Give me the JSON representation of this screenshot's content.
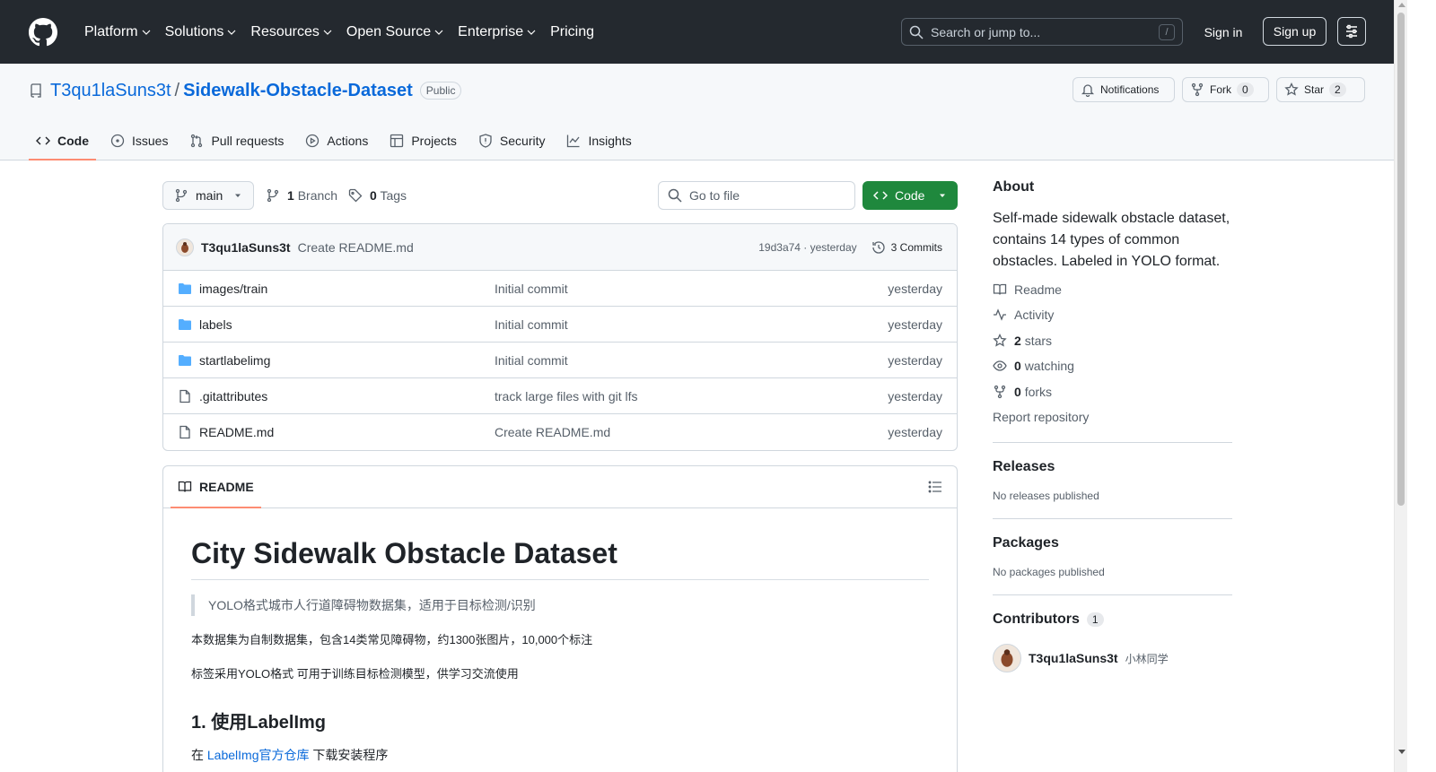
{
  "header": {
    "nav": [
      "Platform",
      "Solutions",
      "Resources",
      "Open Source",
      "Enterprise"
    ],
    "pricing": "Pricing",
    "search_placeholder": "Search or jump to...",
    "search_shortcut": "/",
    "sign_in": "Sign in",
    "sign_up": "Sign up"
  },
  "repo": {
    "owner": "T3qu1laSuns3t",
    "separator": "/",
    "name": "Sidewalk-Obstacle-Dataset",
    "visibility": "Public",
    "notifications": "Notifications",
    "fork_label": "Fork",
    "fork_count": "0",
    "star_label": "Star",
    "star_count": "2",
    "tabs": [
      "Code",
      "Issues",
      "Pull requests",
      "Actions",
      "Projects",
      "Security",
      "Insights"
    ]
  },
  "toolbar": {
    "branch": "main",
    "branch_count": "1",
    "branch_label": "Branch",
    "tag_count": "0",
    "tag_label": "Tags",
    "goto_placeholder": "Go to file",
    "code_button": "Code"
  },
  "latest_commit": {
    "author": "T3qu1laSuns3t",
    "message": "Create README.md",
    "sha_time": "19d3a74 · yesterday",
    "commits": "3 Commits"
  },
  "files": [
    {
      "type": "folder",
      "name": "images/train",
      "message": "Initial commit",
      "date": "yesterday"
    },
    {
      "type": "folder",
      "name": "labels",
      "message": "Initial commit",
      "date": "yesterday"
    },
    {
      "type": "folder",
      "name": "startlabelimg",
      "message": "Initial commit",
      "date": "yesterday"
    },
    {
      "type": "file",
      "name": ".gitattributes",
      "message": "track large files with git lfs",
      "date": "yesterday"
    },
    {
      "type": "file",
      "name": "README.md",
      "message": "Create README.md",
      "date": "yesterday"
    }
  ],
  "readme": {
    "tab": "README",
    "title": "City Sidewalk Obstacle Dataset",
    "quote": "YOLO格式城市人行道障碍物数据集，适用于目标检测/识别",
    "para1": "本数据集为自制数据集，包含14类常见障碍物，约1300张图片，10,000个标注",
    "para2": "标签采用YOLO格式 可用于训练目标检测模型，供学习交流使用",
    "h2": "1. 使用LabelImg",
    "p2_prefix": "在",
    "p2_link": "LabelImg官方仓库",
    "p2_suffix": "下载安装程序"
  },
  "sidebar": {
    "about_title": "About",
    "description": "Self-made sidewalk obstacle dataset, contains 14 types of common obstacles. Labeled in YOLO format.",
    "readme": "Readme",
    "activity": "Activity",
    "stars_count": "2",
    "stars_label": "stars",
    "watching_count": "0",
    "watching_label": "watching",
    "forks_count": "0",
    "forks_label": "forks",
    "report": "Report repository",
    "releases_title": "Releases",
    "releases_empty": "No releases published",
    "packages_title": "Packages",
    "packages_empty": "No packages published",
    "contributors_title": "Contributors",
    "contributors_count": "1",
    "contributor_name": "T3qu1laSuns3t",
    "contributor_note": "小林同学"
  }
}
